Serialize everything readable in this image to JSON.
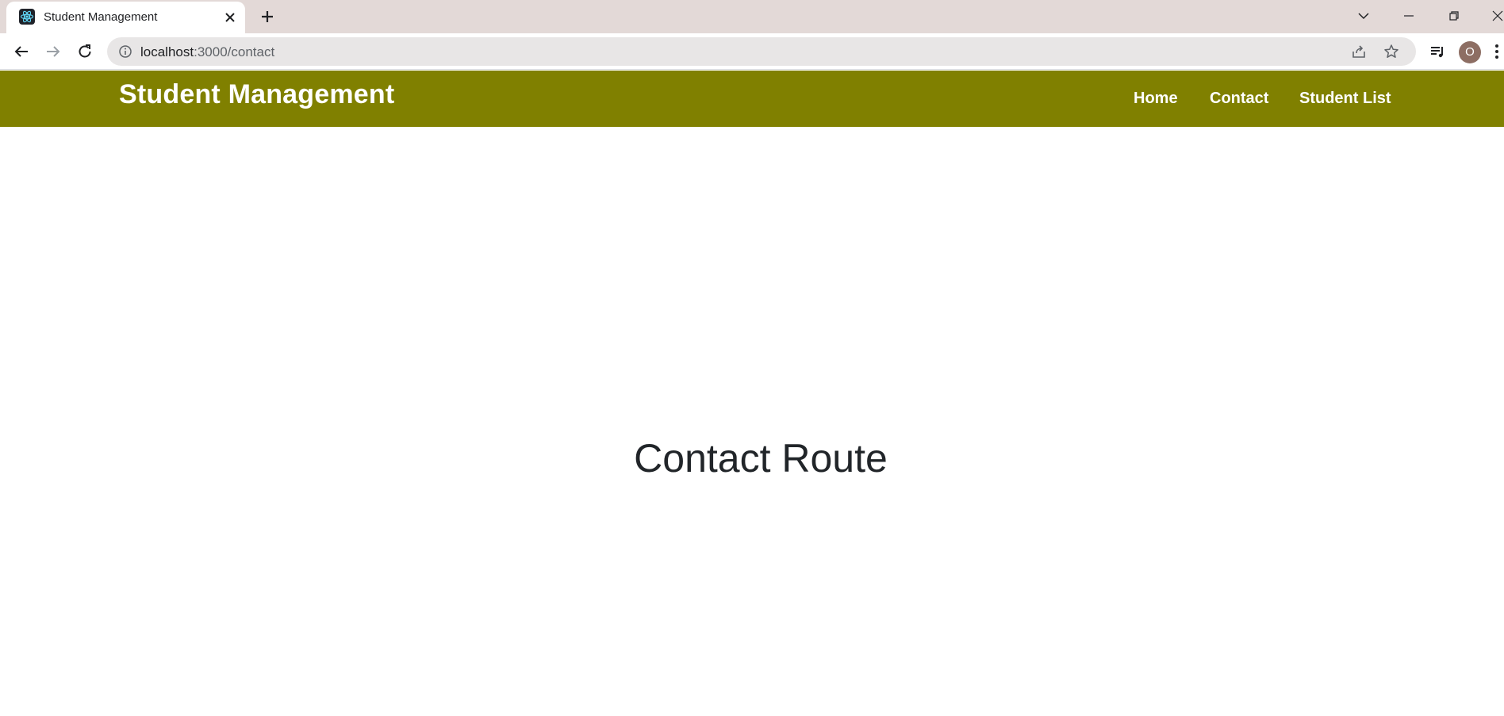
{
  "browser": {
    "tab": {
      "title": "Student Management"
    },
    "address_bar": {
      "host": "localhost",
      "path": ":3000/contact"
    },
    "profile_initial": "O"
  },
  "navbar": {
    "brand": "Student Management",
    "links": [
      {
        "label": "Home"
      },
      {
        "label": "Contact"
      },
      {
        "label": "Student List"
      }
    ],
    "color": "#808000"
  },
  "main": {
    "heading": "Contact Route"
  }
}
